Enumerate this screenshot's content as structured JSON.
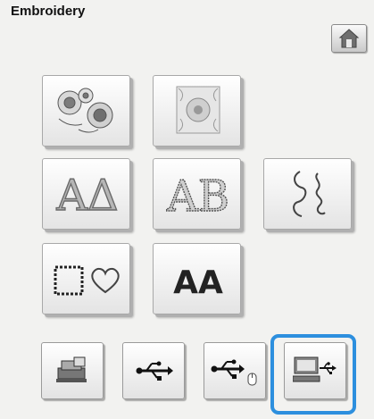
{
  "header": {
    "title": "Embroidery"
  },
  "icons": {
    "home": "home-icon",
    "flower": "flower-pattern-icon",
    "frame_flower": "floral-frame-pattern-icon",
    "alphabet_plain": "alphabet-plain-icon",
    "alphabet_decor": "alphabet-decorative-icon",
    "utility": "utility-embroidery-icon",
    "frame_shapes": "frame-shapes-icon",
    "alphabet_outline": "alphabet-outline-icon",
    "machine": "machine-memory-icon",
    "usb": "usb-icon",
    "usb_mouse": "usb-mouse-icon",
    "computer": "computer-usb-icon"
  },
  "tiles": {
    "a_greek": "AΔ",
    "ab": "AB",
    "aa": "AA"
  },
  "selected": "computer",
  "colors": {
    "selection": "#2d8fde"
  }
}
